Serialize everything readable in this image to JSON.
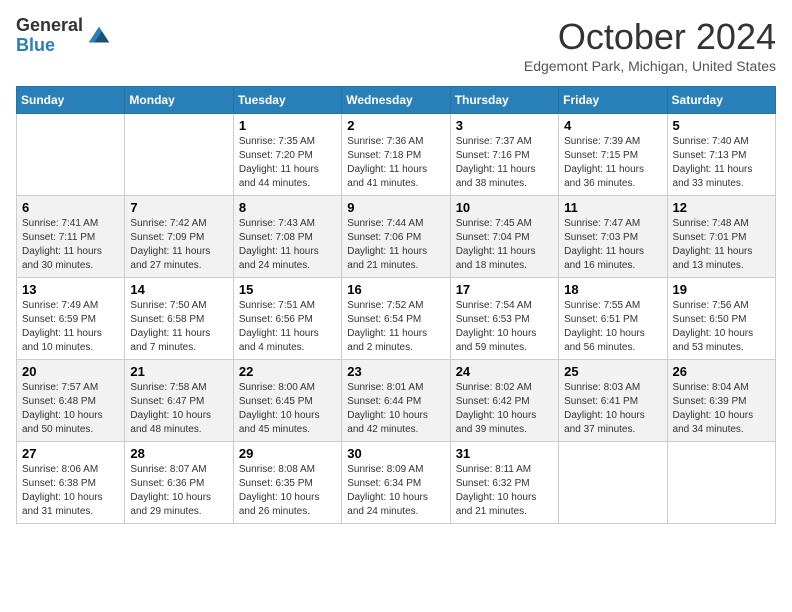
{
  "logo": {
    "line1": "General",
    "line2": "Blue"
  },
  "title": "October 2024",
  "location": "Edgemont Park, Michigan, United States",
  "weekdays": [
    "Sunday",
    "Monday",
    "Tuesday",
    "Wednesday",
    "Thursday",
    "Friday",
    "Saturday"
  ],
  "weeks": [
    [
      {
        "day": "",
        "sunrise": "",
        "sunset": "",
        "daylight": ""
      },
      {
        "day": "",
        "sunrise": "",
        "sunset": "",
        "daylight": ""
      },
      {
        "day": "1",
        "sunrise": "Sunrise: 7:35 AM",
        "sunset": "Sunset: 7:20 PM",
        "daylight": "Daylight: 11 hours and 44 minutes."
      },
      {
        "day": "2",
        "sunrise": "Sunrise: 7:36 AM",
        "sunset": "Sunset: 7:18 PM",
        "daylight": "Daylight: 11 hours and 41 minutes."
      },
      {
        "day": "3",
        "sunrise": "Sunrise: 7:37 AM",
        "sunset": "Sunset: 7:16 PM",
        "daylight": "Daylight: 11 hours and 38 minutes."
      },
      {
        "day": "4",
        "sunrise": "Sunrise: 7:39 AM",
        "sunset": "Sunset: 7:15 PM",
        "daylight": "Daylight: 11 hours and 36 minutes."
      },
      {
        "day": "5",
        "sunrise": "Sunrise: 7:40 AM",
        "sunset": "Sunset: 7:13 PM",
        "daylight": "Daylight: 11 hours and 33 minutes."
      }
    ],
    [
      {
        "day": "6",
        "sunrise": "Sunrise: 7:41 AM",
        "sunset": "Sunset: 7:11 PM",
        "daylight": "Daylight: 11 hours and 30 minutes."
      },
      {
        "day": "7",
        "sunrise": "Sunrise: 7:42 AM",
        "sunset": "Sunset: 7:09 PM",
        "daylight": "Daylight: 11 hours and 27 minutes."
      },
      {
        "day": "8",
        "sunrise": "Sunrise: 7:43 AM",
        "sunset": "Sunset: 7:08 PM",
        "daylight": "Daylight: 11 hours and 24 minutes."
      },
      {
        "day": "9",
        "sunrise": "Sunrise: 7:44 AM",
        "sunset": "Sunset: 7:06 PM",
        "daylight": "Daylight: 11 hours and 21 minutes."
      },
      {
        "day": "10",
        "sunrise": "Sunrise: 7:45 AM",
        "sunset": "Sunset: 7:04 PM",
        "daylight": "Daylight: 11 hours and 18 minutes."
      },
      {
        "day": "11",
        "sunrise": "Sunrise: 7:47 AM",
        "sunset": "Sunset: 7:03 PM",
        "daylight": "Daylight: 11 hours and 16 minutes."
      },
      {
        "day": "12",
        "sunrise": "Sunrise: 7:48 AM",
        "sunset": "Sunset: 7:01 PM",
        "daylight": "Daylight: 11 hours and 13 minutes."
      }
    ],
    [
      {
        "day": "13",
        "sunrise": "Sunrise: 7:49 AM",
        "sunset": "Sunset: 6:59 PM",
        "daylight": "Daylight: 11 hours and 10 minutes."
      },
      {
        "day": "14",
        "sunrise": "Sunrise: 7:50 AM",
        "sunset": "Sunset: 6:58 PM",
        "daylight": "Daylight: 11 hours and 7 minutes."
      },
      {
        "day": "15",
        "sunrise": "Sunrise: 7:51 AM",
        "sunset": "Sunset: 6:56 PM",
        "daylight": "Daylight: 11 hours and 4 minutes."
      },
      {
        "day": "16",
        "sunrise": "Sunrise: 7:52 AM",
        "sunset": "Sunset: 6:54 PM",
        "daylight": "Daylight: 11 hours and 2 minutes."
      },
      {
        "day": "17",
        "sunrise": "Sunrise: 7:54 AM",
        "sunset": "Sunset: 6:53 PM",
        "daylight": "Daylight: 10 hours and 59 minutes."
      },
      {
        "day": "18",
        "sunrise": "Sunrise: 7:55 AM",
        "sunset": "Sunset: 6:51 PM",
        "daylight": "Daylight: 10 hours and 56 minutes."
      },
      {
        "day": "19",
        "sunrise": "Sunrise: 7:56 AM",
        "sunset": "Sunset: 6:50 PM",
        "daylight": "Daylight: 10 hours and 53 minutes."
      }
    ],
    [
      {
        "day": "20",
        "sunrise": "Sunrise: 7:57 AM",
        "sunset": "Sunset: 6:48 PM",
        "daylight": "Daylight: 10 hours and 50 minutes."
      },
      {
        "day": "21",
        "sunrise": "Sunrise: 7:58 AM",
        "sunset": "Sunset: 6:47 PM",
        "daylight": "Daylight: 10 hours and 48 minutes."
      },
      {
        "day": "22",
        "sunrise": "Sunrise: 8:00 AM",
        "sunset": "Sunset: 6:45 PM",
        "daylight": "Daylight: 10 hours and 45 minutes."
      },
      {
        "day": "23",
        "sunrise": "Sunrise: 8:01 AM",
        "sunset": "Sunset: 6:44 PM",
        "daylight": "Daylight: 10 hours and 42 minutes."
      },
      {
        "day": "24",
        "sunrise": "Sunrise: 8:02 AM",
        "sunset": "Sunset: 6:42 PM",
        "daylight": "Daylight: 10 hours and 39 minutes."
      },
      {
        "day": "25",
        "sunrise": "Sunrise: 8:03 AM",
        "sunset": "Sunset: 6:41 PM",
        "daylight": "Daylight: 10 hours and 37 minutes."
      },
      {
        "day": "26",
        "sunrise": "Sunrise: 8:04 AM",
        "sunset": "Sunset: 6:39 PM",
        "daylight": "Daylight: 10 hours and 34 minutes."
      }
    ],
    [
      {
        "day": "27",
        "sunrise": "Sunrise: 8:06 AM",
        "sunset": "Sunset: 6:38 PM",
        "daylight": "Daylight: 10 hours and 31 minutes."
      },
      {
        "day": "28",
        "sunrise": "Sunrise: 8:07 AM",
        "sunset": "Sunset: 6:36 PM",
        "daylight": "Daylight: 10 hours and 29 minutes."
      },
      {
        "day": "29",
        "sunrise": "Sunrise: 8:08 AM",
        "sunset": "Sunset: 6:35 PM",
        "daylight": "Daylight: 10 hours and 26 minutes."
      },
      {
        "day": "30",
        "sunrise": "Sunrise: 8:09 AM",
        "sunset": "Sunset: 6:34 PM",
        "daylight": "Daylight: 10 hours and 24 minutes."
      },
      {
        "day": "31",
        "sunrise": "Sunrise: 8:11 AM",
        "sunset": "Sunset: 6:32 PM",
        "daylight": "Daylight: 10 hours and 21 minutes."
      },
      {
        "day": "",
        "sunrise": "",
        "sunset": "",
        "daylight": ""
      },
      {
        "day": "",
        "sunrise": "",
        "sunset": "",
        "daylight": ""
      }
    ]
  ]
}
